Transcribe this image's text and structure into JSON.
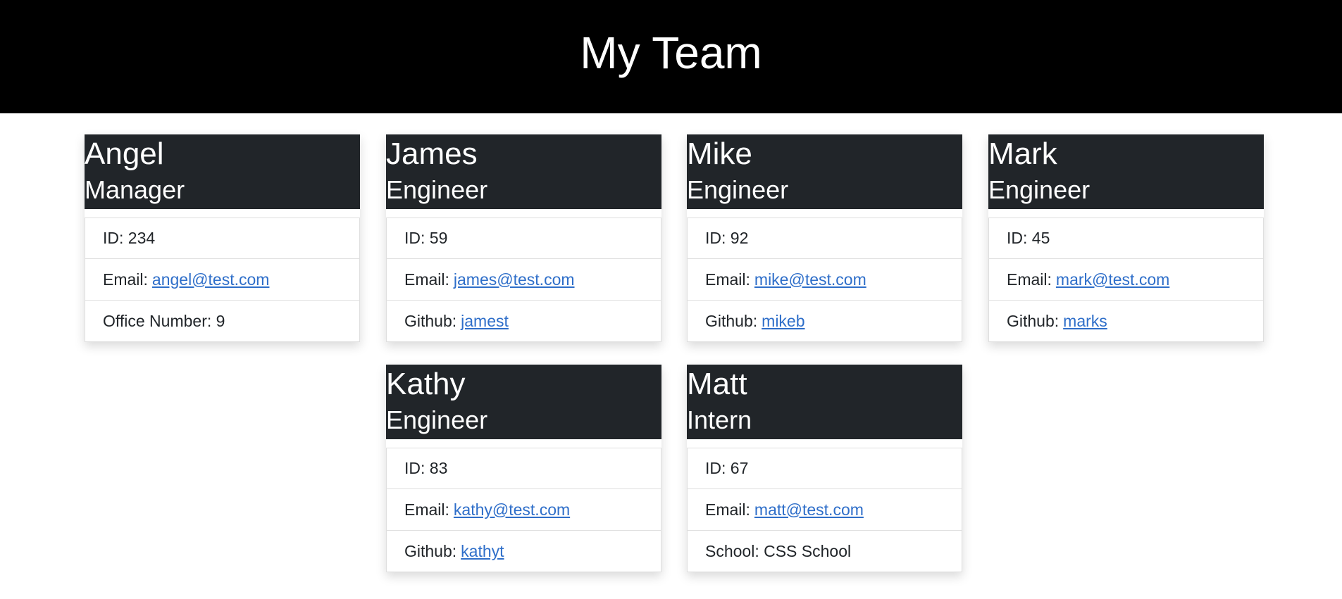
{
  "header": {
    "title": "My Team"
  },
  "cards": [
    {
      "name": "Angel",
      "role": "Manager",
      "id_label": "ID: 234",
      "email_prefix": "Email:",
      "email": "angel@test.com",
      "extra_label": "Office Number: 9"
    },
    {
      "name": "James",
      "role": "Engineer",
      "id_label": "ID: 59",
      "email_prefix": "Email:",
      "email": "james@test.com",
      "extra_prefix": "Github:",
      "extra_link": "jamest"
    },
    {
      "name": "Mike",
      "role": "Engineer",
      "id_label": "ID: 92",
      "email_prefix": "Email:",
      "email": "mike@test.com",
      "extra_prefix": "Github:",
      "extra_link": "mikeb"
    },
    {
      "name": "Mark",
      "role": "Engineer",
      "id_label": "ID: 45",
      "email_prefix": "Email:",
      "email": "mark@test.com",
      "extra_prefix": "Github:",
      "extra_link": "marks"
    },
    {
      "name": "Kathy",
      "role": "Engineer",
      "id_label": "ID: 83",
      "email_prefix": "Email:",
      "email": "kathy@test.com",
      "extra_prefix": "Github:",
      "extra_link": "kathyt"
    },
    {
      "name": "Matt",
      "role": "Intern",
      "id_label": "ID: 67",
      "email_prefix": "Email:",
      "email": "matt@test.com",
      "extra_label": "School: CSS School"
    }
  ]
}
